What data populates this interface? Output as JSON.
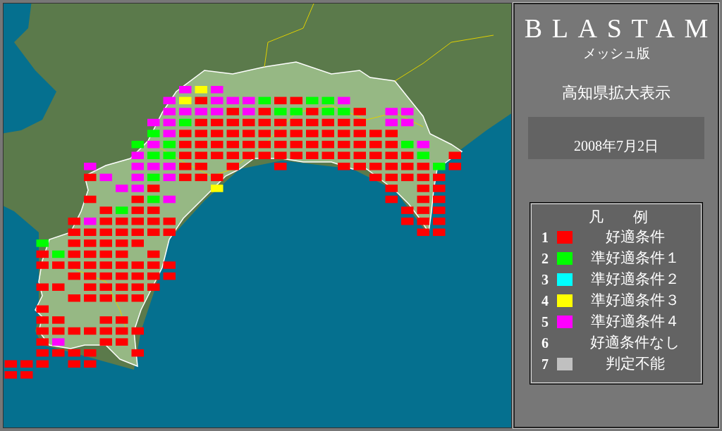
{
  "panel": {
    "title": "BLASTAM",
    "subtitle": "メッシュ版",
    "region": "高知県拡大表示",
    "date": "2008年7月2日"
  },
  "legend": {
    "title": "凡　　例",
    "items": [
      {
        "number": "1",
        "label": "好適条件",
        "color": "#ff0000"
      },
      {
        "number": "2",
        "label": "準好適条件１",
        "color": "#00ff00"
      },
      {
        "number": "3",
        "label": "準好適条件２",
        "color": "#00ffff"
      },
      {
        "number": "4",
        "label": "準好適条件３",
        "color": "#ffff00"
      },
      {
        "number": "5",
        "label": "準好適条件４",
        "color": "#ff00ff"
      },
      {
        "number": "6",
        "label": "好適条件なし"
      },
      {
        "number": "7",
        "label": "判定不能",
        "color": "#c0c0c0"
      }
    ]
  },
  "mesh_rows": [
    {
      "cells": [
        null,
        null,
        null,
        null,
        null,
        null,
        null,
        null,
        null,
        null,
        null,
        {
          "color": "#ff00ff"
        },
        {
          "color": "#ffff00"
        },
        {
          "color": "#ff00ff"
        }
      ]
    },
    {
      "cells": [
        null,
        null,
        null,
        null,
        null,
        null,
        null,
        null,
        null,
        null,
        {
          "color": "#ff00ff"
        },
        {
          "color": "#ffff00"
        },
        {
          "color": "#ff0000"
        },
        {
          "color": "#ff00ff"
        },
        {
          "color": "#ff00ff"
        },
        {
          "color": "#ff00ff"
        },
        {
          "color": "#00ff00"
        },
        {
          "color": "#ff0000"
        },
        {
          "color": "#ff0000"
        },
        {
          "color": "#00ff00"
        },
        {
          "color": "#00ff00"
        },
        {
          "color": "#ff00ff"
        }
      ]
    },
    {
      "cells": [
        null,
        null,
        null,
        null,
        null,
        null,
        null,
        null,
        null,
        null,
        {
          "color": "#ff00ff"
        },
        {
          "color": "#ff00ff"
        },
        {
          "color": "#ff00ff"
        },
        {
          "color": "#ff00ff"
        },
        {
          "color": "#ff0000"
        },
        {
          "color": "#ff00ff"
        },
        {
          "color": "#ff0000"
        },
        {
          "color": "#00ff00"
        },
        {
          "color": "#00ff00"
        },
        {
          "color": "#ff0000"
        },
        {
          "color": "#00ff00"
        },
        {
          "color": "#00ff00"
        },
        {
          "color": "#ff0000"
        },
        null,
        {
          "color": "#ff00ff"
        },
        {
          "color": "#ff00ff"
        }
      ]
    },
    {
      "cells": [
        null,
        null,
        null,
        null,
        null,
        null,
        null,
        null,
        null,
        {
          "color": "#ff00ff"
        },
        {
          "color": "#ff00ff"
        },
        {
          "color": "#00ff00"
        },
        {
          "color": "#ff0000"
        },
        {
          "color": "#ff0000"
        },
        {
          "color": "#ff0000"
        },
        {
          "color": "#ff0000"
        },
        {
          "color": "#ff0000"
        },
        {
          "color": "#ff0000"
        },
        {
          "color": "#ff0000"
        },
        {
          "color": "#ff0000"
        },
        {
          "color": "#ff0000"
        },
        {
          "color": "#ff0000"
        },
        {
          "color": "#ff0000"
        },
        null,
        {
          "color": "#ff00ff"
        },
        {
          "color": "#ff00ff"
        }
      ]
    },
    {
      "cells": [
        null,
        null,
        null,
        null,
        null,
        null,
        null,
        null,
        null,
        {
          "color": "#00ff00"
        },
        {
          "color": "#ff00ff"
        },
        {
          "color": "#ff0000"
        },
        {
          "color": "#ff0000"
        },
        {
          "color": "#ff0000"
        },
        {
          "color": "#ff0000"
        },
        {
          "color": "#ff0000"
        },
        {
          "color": "#ff0000"
        },
        {
          "color": "#ff0000"
        },
        {
          "color": "#ff0000"
        },
        {
          "color": "#ff0000"
        },
        {
          "color": "#ff0000"
        },
        {
          "color": "#ff0000"
        },
        {
          "color": "#ff0000"
        },
        {
          "color": "#ff0000"
        },
        {
          "color": "#ff0000"
        }
      ]
    },
    {
      "cells": [
        null,
        null,
        null,
        null,
        null,
        null,
        null,
        null,
        {
          "color": "#00ff00"
        },
        {
          "color": "#ff00ff"
        },
        {
          "color": "#00ff00"
        },
        {
          "color": "#ff0000"
        },
        {
          "color": "#ff0000"
        },
        {
          "color": "#ff0000"
        },
        {
          "color": "#ff0000"
        },
        {
          "color": "#ff0000"
        },
        {
          "color": "#ff0000"
        },
        {
          "color": "#ff0000"
        },
        {
          "color": "#ff0000"
        },
        {
          "color": "#ff0000"
        },
        {
          "color": "#ff0000"
        },
        {
          "color": "#ff0000"
        },
        {
          "color": "#ff0000"
        },
        {
          "color": "#ff0000"
        },
        {
          "color": "#ff0000"
        },
        {
          "color": "#00ff00"
        },
        {
          "color": "#ff00ff"
        }
      ]
    },
    {
      "cells": [
        null,
        null,
        null,
        null,
        null,
        null,
        null,
        null,
        {
          "color": "#ff00ff"
        },
        {
          "color": "#00ff00"
        },
        {
          "color": "#00ff00"
        },
        {
          "color": "#ff0000"
        },
        {
          "color": "#ff0000"
        },
        {
          "color": "#ff0000"
        },
        {
          "color": "#ff0000"
        },
        {
          "color": "#ff0000"
        },
        {
          "color": "#ff0000"
        },
        {
          "color": "#ff0000"
        },
        {
          "color": "#ff0000"
        },
        {
          "color": "#ff0000"
        },
        {
          "color": "#ff0000"
        },
        {
          "color": "#ff0000"
        },
        {
          "color": "#ff0000"
        },
        {
          "color": "#ff0000"
        },
        {
          "color": "#ff0000"
        },
        {
          "color": "#ff0000"
        },
        {
          "color": "#00ff00"
        },
        null,
        {
          "color": "#ff0000"
        }
      ]
    },
    {
      "cells": [
        null,
        null,
        null,
        null,
        null,
        {
          "color": "#ff00ff"
        },
        null,
        null,
        {
          "color": "#ff00ff"
        },
        {
          "color": "#ff00ff"
        },
        {
          "color": "#ff00ff"
        },
        {
          "color": "#ff0000"
        },
        {
          "color": "#ff0000"
        },
        null,
        {
          "color": "#ff0000"
        },
        null,
        null,
        {
          "color": "#ff0000"
        },
        null,
        null,
        null,
        {
          "color": "#ff0000"
        },
        {
          "color": "#ff0000"
        },
        {
          "color": "#ff0000"
        },
        {
          "color": "#ff0000"
        },
        {
          "color": "#ff0000"
        },
        {
          "color": "#ff0000"
        },
        {
          "color": "#00ff00"
        },
        {
          "color": "#ff0000"
        }
      ]
    },
    {
      "cells": [
        null,
        null,
        null,
        null,
        null,
        {
          "color": "#ff0000"
        },
        {
          "color": "#ff00ff"
        },
        null,
        {
          "color": "#ff00ff"
        },
        {
          "color": "#00ff00"
        },
        {
          "color": "#ff00ff"
        },
        {
          "color": "#ff0000"
        },
        {
          "color": "#ff0000"
        },
        {
          "color": "#ff0000"
        },
        null,
        null,
        null,
        null,
        null,
        null,
        null,
        null,
        null,
        {
          "color": "#ff0000"
        },
        {
          "color": "#ff0000"
        },
        {
          "color": "#ff0000"
        },
        {
          "color": "#ff0000"
        },
        {
          "color": "#ff0000"
        }
      ]
    },
    {
      "cells": [
        null,
        null,
        null,
        null,
        null,
        null,
        null,
        {
          "color": "#ff00ff"
        },
        {
          "color": "#ff00ff"
        },
        {
          "color": "#ff0000"
        },
        null,
        null,
        null,
        {
          "color": "#ffff00"
        },
        null,
        null,
        null,
        null,
        null,
        null,
        null,
        null,
        null,
        null,
        {
          "color": "#ff0000"
        },
        null,
        {
          "color": "#ff0000"
        },
        {
          "color": "#ff0000"
        }
      ]
    },
    {
      "cells": [
        null,
        null,
        null,
        null,
        null,
        {
          "color": "#ff0000"
        },
        null,
        null,
        {
          "color": "#ff0000"
        },
        {
          "color": "#00ff00"
        },
        {
          "color": "#ff00ff"
        },
        null,
        null,
        null,
        null,
        null,
        null,
        null,
        null,
        null,
        null,
        null,
        null,
        null,
        {
          "color": "#ff0000"
        },
        null,
        {
          "color": "#ff0000"
        },
        {
          "color": "#ff0000"
        }
      ]
    },
    {
      "cells": [
        null,
        null,
        null,
        null,
        null,
        null,
        {
          "color": "#ff0000"
        },
        {
          "color": "#00ff00"
        },
        {
          "color": "#ff0000"
        },
        {
          "color": "#ff0000"
        },
        null,
        null,
        null,
        null,
        null,
        null,
        null,
        null,
        null,
        null,
        null,
        null,
        null,
        null,
        null,
        {
          "color": "#ff0000"
        },
        {
          "color": "#ff0000"
        },
        {
          "color": "#ff0000"
        }
      ]
    },
    {
      "cells": [
        null,
        null,
        null,
        null,
        {
          "color": "#ff0000"
        },
        {
          "color": "#ff00ff"
        },
        {
          "color": "#ff0000"
        },
        {
          "color": "#ff0000"
        },
        {
          "color": "#ff0000"
        },
        {
          "color": "#ff0000"
        },
        {
          "color": "#ff0000"
        },
        null,
        null,
        null,
        null,
        null,
        null,
        null,
        null,
        null,
        null,
        null,
        null,
        null,
        null,
        {
          "color": "#ff0000"
        },
        {
          "color": "#ff0000"
        },
        {
          "color": "#ff0000"
        }
      ]
    },
    {
      "cells": [
        null,
        null,
        null,
        null,
        {
          "color": "#ff0000"
        },
        {
          "color": "#ff0000"
        },
        {
          "color": "#ff0000"
        },
        {
          "color": "#ff0000"
        },
        {
          "color": "#ff0000"
        },
        {
          "color": "#ff0000"
        },
        {
          "color": "#ff0000"
        },
        null,
        null,
        null,
        null,
        null,
        null,
        null,
        null,
        null,
        null,
        null,
        null,
        null,
        null,
        null,
        {
          "color": "#ff0000"
        },
        {
          "color": "#ff0000"
        }
      ]
    },
    {
      "cells": [
        null,
        null,
        {
          "color": "#00ff00"
        },
        null,
        {
          "color": "#ff0000"
        },
        {
          "color": "#ff0000"
        },
        {
          "color": "#ff0000"
        },
        {
          "color": "#ff0000"
        },
        {
          "color": "#ff0000"
        }
      ]
    },
    {
      "cells": [
        null,
        null,
        {
          "color": "#ff0000"
        },
        {
          "color": "#00ff00"
        },
        {
          "color": "#ff0000"
        },
        {
          "color": "#ff0000"
        },
        {
          "color": "#ff0000"
        },
        {
          "color": "#ff0000"
        },
        null,
        {
          "color": "#ff0000"
        }
      ]
    },
    {
      "cells": [
        null,
        null,
        {
          "color": "#ff0000"
        },
        {
          "color": "#ff0000"
        },
        {
          "color": "#ff0000"
        },
        {
          "color": "#ff0000"
        },
        {
          "color": "#ff0000"
        },
        {
          "color": "#ff0000"
        },
        {
          "color": "#ff0000"
        },
        {
          "color": "#ff0000"
        },
        {
          "color": "#ff0000"
        }
      ]
    },
    {
      "cells": [
        null,
        null,
        null,
        null,
        {
          "color": "#ff0000"
        },
        {
          "color": "#ff0000"
        },
        {
          "color": "#ff0000"
        },
        {
          "color": "#ff0000"
        },
        {
          "color": "#ff0000"
        },
        {
          "color": "#ff0000"
        },
        {
          "color": "#ff0000"
        }
      ]
    },
    {
      "cells": [
        null,
        null,
        {
          "color": "#ff0000"
        },
        {
          "color": "#ff0000"
        },
        null,
        {
          "color": "#ff0000"
        },
        {
          "color": "#ff0000"
        },
        {
          "color": "#ff0000"
        },
        {
          "color": "#ff0000"
        },
        {
          "color": "#ff0000"
        }
      ]
    },
    {
      "cells": [
        null,
        null,
        null,
        null,
        {
          "color": "#ff0000"
        },
        {
          "color": "#ff0000"
        },
        {
          "color": "#ff0000"
        },
        {
          "color": "#ff0000"
        },
        {
          "color": "#ff0000"
        }
      ]
    },
    {
      "cells": [
        null,
        null,
        {
          "color": "#ff0000"
        }
      ]
    },
    {
      "cells": [
        null,
        null,
        {
          "color": "#ff0000"
        },
        {
          "color": "#ff0000"
        },
        null,
        null,
        {
          "color": "#ff0000"
        },
        {
          "color": "#ff0000"
        }
      ]
    },
    {
      "cells": [
        null,
        null,
        {
          "color": "#ff0000"
        },
        {
          "color": "#ff0000"
        },
        {
          "color": "#ff0000"
        },
        {
          "color": "#ff0000"
        },
        {
          "color": "#ff0000"
        },
        {
          "color": "#ff0000"
        },
        {
          "color": "#ff0000"
        }
      ]
    },
    {
      "cells": [
        null,
        null,
        {
          "color": "#ff0000"
        },
        {
          "color": "#ff00ff"
        },
        null,
        null,
        {
          "color": "#ff0000"
        },
        {
          "color": "#ff0000"
        }
      ]
    },
    {
      "cells": [
        null,
        null,
        {
          "color": "#ff0000"
        },
        {
          "color": "#ff0000"
        },
        {
          "color": "#ff0000"
        },
        {
          "color": "#ff0000"
        },
        null,
        null,
        {
          "color": "#ff0000"
        }
      ]
    },
    {
      "cells": [
        {
          "color": "#ff0000"
        },
        {
          "color": "#ff0000"
        },
        {
          "color": "#ff0000"
        },
        null,
        {
          "color": "#ff0000"
        },
        {
          "color": "#ff0000"
        }
      ]
    },
    {
      "cells": [
        {
          "color": "#ff0000"
        },
        {
          "color": "#ff0000"
        }
      ]
    }
  ]
}
